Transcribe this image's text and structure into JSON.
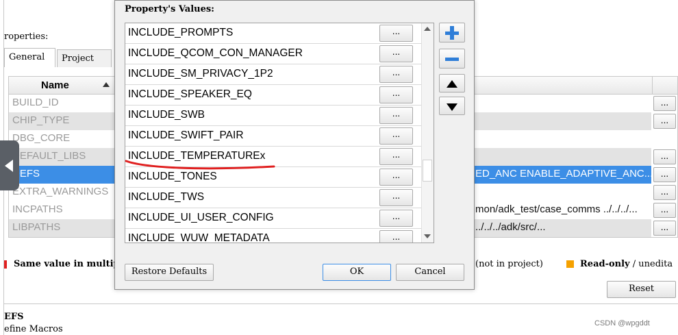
{
  "background": {
    "properties_label": "roperties:",
    "tabs": [
      {
        "label": "General"
      },
      {
        "label": "Project"
      }
    ],
    "grid": {
      "name_header": "Name",
      "rows": [
        {
          "name": "BUILD_ID",
          "value": ""
        },
        {
          "name": "CHIP_TYPE",
          "value": ""
        },
        {
          "name": "DBG_CORE",
          "value": ""
        },
        {
          "name": "DEFAULT_LIBS",
          "value": ""
        },
        {
          "name": "DEFS",
          "value": "ED_ANC ENABLE_ADAPTIVE_ANC..."
        },
        {
          "name": "EXTRA_WARNINGS",
          "value": ""
        },
        {
          "name": "INCPATHS",
          "value": "mon/adk_test/case_comms ../../../..."
        },
        {
          "name": "LIBPATHS",
          "value": "../../../adk/src/..."
        }
      ]
    },
    "legend": {
      "same_value_text": "Same value in multip",
      "not_in_project_text": "(not in project)",
      "readonly_label": "Read-only",
      "readonly_rest": "/ unedita"
    },
    "reset_button": "Reset",
    "footer_title": "EFS",
    "footer_desc": "efine Macros",
    "watermark": "CSDN @wpgddt",
    "colors": {
      "selected_row": "#3c8ee6",
      "legend_red": "#e02020",
      "legend_orange": "#f5a100"
    }
  },
  "dialog": {
    "label": "Property's Values:",
    "dots_label": "...",
    "items": [
      "INCLUDE_PROMPTS",
      "INCLUDE_QCOM_CON_MANAGER",
      "INCLUDE_SM_PRIVACY_1P2",
      "INCLUDE_SPEAKER_EQ",
      "INCLUDE_SWB",
      "INCLUDE_SWIFT_PAIR",
      "INCLUDE_TEMPERATUREx",
      "INCLUDE_TONES",
      "INCLUDE_TWS",
      "INCLUDE_UI_USER_CONFIG",
      "INCLUDE_WUW_METADATA"
    ],
    "restore_defaults": "Restore Defaults",
    "ok": "OK",
    "cancel": "Cancel",
    "side_icons": [
      "plus-icon",
      "minus-icon",
      "arrow-up-icon",
      "arrow-down-icon"
    ]
  }
}
